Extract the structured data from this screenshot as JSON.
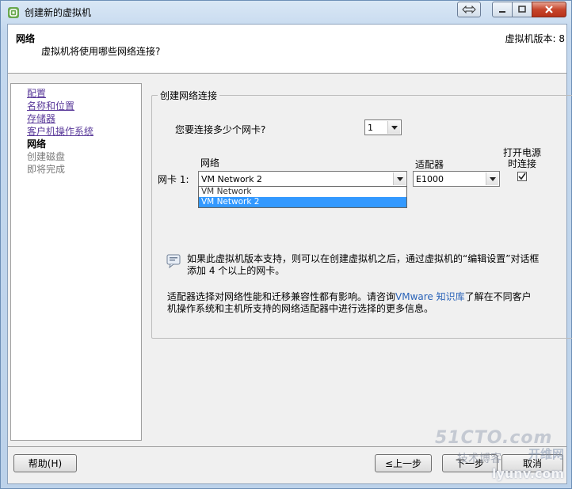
{
  "window": {
    "title": "创建新的虚拟机",
    "buttons": {
      "swap": "⇔",
      "minimize": "–",
      "maximize": "□",
      "close": "X"
    }
  },
  "header": {
    "title": "网络",
    "subtitle": "虚拟机将使用哪些网络连接?",
    "version": "虚拟机版本: 8"
  },
  "nav": {
    "items": [
      {
        "label": "配置",
        "state": "link"
      },
      {
        "label": "名称和位置",
        "state": "link"
      },
      {
        "label": "存储器",
        "state": "link"
      },
      {
        "label": "客户机操作系统",
        "state": "link"
      },
      {
        "label": "网络",
        "state": "current"
      },
      {
        "label": "创建磁盘",
        "state": "disabled"
      },
      {
        "label": "即将完成",
        "state": "disabled"
      }
    ]
  },
  "main": {
    "group_title": "创建网络连接",
    "nic_count_question": "您要连接多少个网卡?",
    "nic_count_value": "1",
    "columns": {
      "network": "网络",
      "adapter": "适配器",
      "power_on_line1": "打开电源",
      "power_on_line2": "时连接"
    },
    "nic_row": {
      "label": "网卡 1:",
      "network_value": "VM Network 2",
      "adapter_value": "E1000",
      "connect_at_power_on": true
    },
    "network_dropdown": {
      "options": [
        "VM Network",
        "VM Network 2"
      ],
      "selected_index": 1
    },
    "info_text": "如果此虚拟机版本支持，则可以在创建虚拟机之后，通过虚拟机的“编辑设置”对话框添加 4 个以上的网卡。",
    "adapter_note_before": "适配器选择对网络性能和迁移兼容性都有影响。请咨询",
    "adapter_note_link": "VMware 知识库",
    "adapter_note_after": "了解在不同客户机操作系统和主机所支持的网络适配器中进行选择的更多信息。"
  },
  "footer": {
    "help": "帮助(H)",
    "back": "≤上一步",
    "next": "下一步",
    "cancel": "取消"
  },
  "watermark": {
    "line1": "51CTO.com",
    "line2": "技术博客",
    "line3": "lyunv.com",
    "line4": "开维网"
  }
}
